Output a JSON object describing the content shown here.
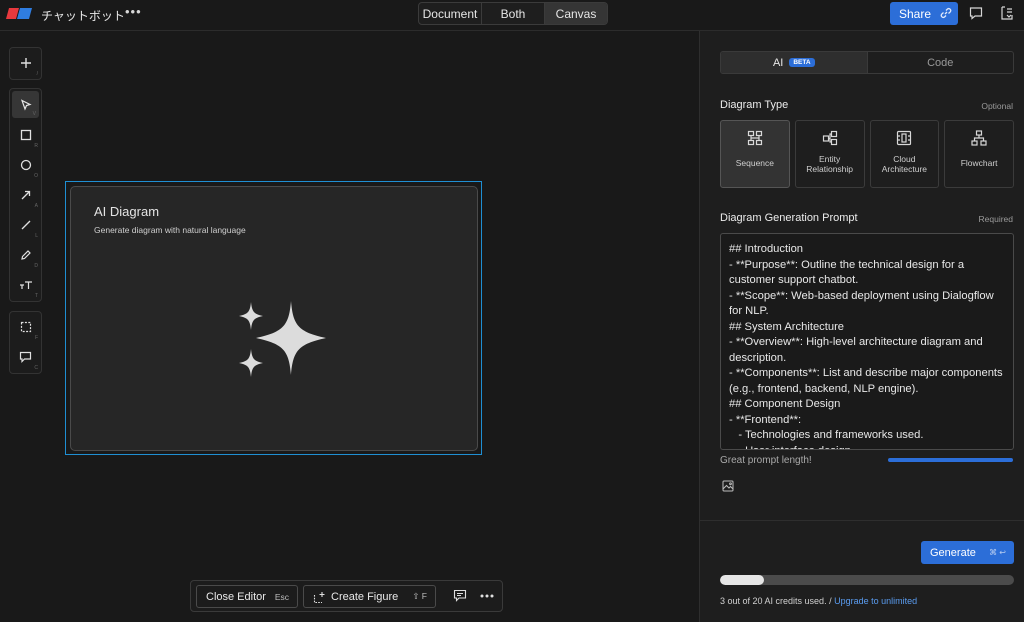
{
  "app": {
    "title": "チャットボット",
    "more_label": "•••",
    "view_modes": [
      {
        "label": "Document",
        "active": false
      },
      {
        "label": "Both",
        "active": false
      },
      {
        "label": "Canvas",
        "active": true
      }
    ],
    "share_label": "Share",
    "accent_color": "#2c6ed8"
  },
  "toolbar": {
    "groups": [
      [
        {
          "name": "add",
          "icon": "plus-icon",
          "key": "/"
        }
      ],
      [
        {
          "name": "select",
          "icon": "cursor-icon",
          "key": "V",
          "active": true
        },
        {
          "name": "rectangle",
          "icon": "square-icon",
          "key": "R"
        },
        {
          "name": "ellipse",
          "icon": "circle-icon",
          "key": "O"
        },
        {
          "name": "arrow",
          "icon": "arrow-icon",
          "key": "A"
        },
        {
          "name": "line",
          "icon": "line-icon",
          "key": "L"
        },
        {
          "name": "pencil",
          "icon": "pencil-icon",
          "key": "D"
        },
        {
          "name": "text",
          "icon": "text-icon",
          "key": "T"
        }
      ],
      [
        {
          "name": "frame",
          "icon": "frame-icon",
          "key": "F"
        },
        {
          "name": "comment",
          "icon": "comment-icon",
          "key": "C"
        }
      ]
    ]
  },
  "figure": {
    "title": "AI Diagram",
    "subtitle": "Generate diagram with natural language",
    "icon": "sparkles-icon"
  },
  "bottom_bar": {
    "close_label": "Close Editor",
    "close_key": "Esc",
    "create_label": "Create Figure",
    "create_key": "⇧ F"
  },
  "panel": {
    "tabs": [
      {
        "label": "AI",
        "badge": "BETA",
        "active": true
      },
      {
        "label": "Code",
        "active": false
      }
    ],
    "diagram_type": {
      "title": "Diagram Type",
      "hint": "Optional",
      "options": [
        {
          "label": "Sequence",
          "icon": "sequence-icon",
          "active": true
        },
        {
          "label": "Entity\nRelationship",
          "icon": "entity-relationship-icon",
          "active": false
        },
        {
          "label": "Cloud\nArchitecture",
          "icon": "cloud-architecture-icon",
          "active": false
        },
        {
          "label": "Flowchart",
          "icon": "flowchart-icon",
          "active": false
        }
      ]
    },
    "prompt": {
      "title": "Diagram Generation Prompt",
      "hint": "Required",
      "value": "## Introduction\n- **Purpose**: Outline the technical design for a customer support chatbot.\n- **Scope**: Web-based deployment using Dialogflow for NLP.\n## System Architecture\n- **Overview**: High-level architecture diagram and description.\n- **Components**: List and describe major components (e.g., frontend, backend, NLP engine).\n## Component Design\n- **Frontend**:\n   - Technologies and frameworks used.\n   - User interface design."
    },
    "length_status": "Great prompt length!",
    "length_fraction": 1.0,
    "generate_label": "Generate",
    "generate_key": "⌘ ↩",
    "credits": {
      "used": 3,
      "total": 20,
      "text": "3 out of 20 AI credits used. /",
      "link": "Upgrade to unlimited"
    }
  }
}
